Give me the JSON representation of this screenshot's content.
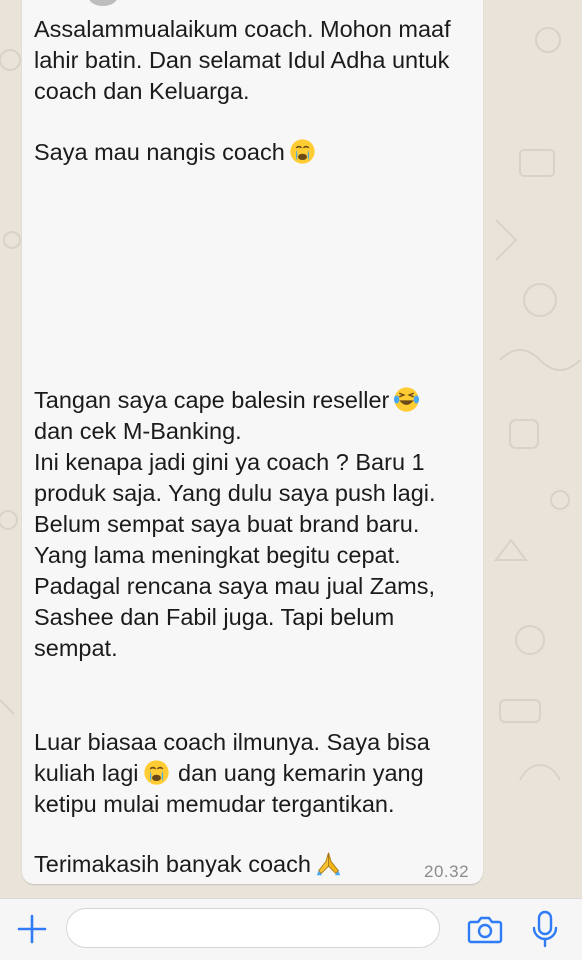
{
  "conversation": {
    "message": {
      "paragraph1": "Assalammualaikum coach. Mohon maaf\nlahir batin. Dan selamat Idul Adha untuk\ncoach dan Keluarga.",
      "paragraph2": "Saya mau nangis coach",
      "paragraph2_emoji": "crying-face-emoji",
      "paragraph3_line1": "Tangan saya cape balesin reseller",
      "paragraph3_line1_emoji": "tears-of-joy-emoji",
      "paragraph3_rest": "dan cek M-Banking.\nIni kenapa jadi gini ya coach ?  Baru 1\nproduk saja. Yang dulu saya push lagi.\nBelum sempat saya buat brand baru.\nYang lama meningkat begitu cepat.\nPadagal rencana saya mau jual Zams,\nSashee dan Fabil juga. Tapi belum\nsempat.",
      "paragraph4_line1": "Luar biasaa coach ilmunya. Saya bisa",
      "paragraph4_line2_before": "kuliah lagi",
      "paragraph4_line2_emoji": "crying-face-emoji",
      "paragraph4_line2_after": " dan uang kemarin yang",
      "paragraph4_line3": "ketipu mulai memudar tergantikan.",
      "paragraph5": "Terimakasih banyak coach",
      "paragraph5_emoji": "folded-hands-emoji",
      "time": "20.32"
    }
  },
  "input_bar": {
    "plus_icon": "plus-icon",
    "input_value": "",
    "input_placeholder": "",
    "camera_icon": "camera-icon",
    "mic_icon": "microphone-icon",
    "accent_color": "#2f7cf6"
  }
}
